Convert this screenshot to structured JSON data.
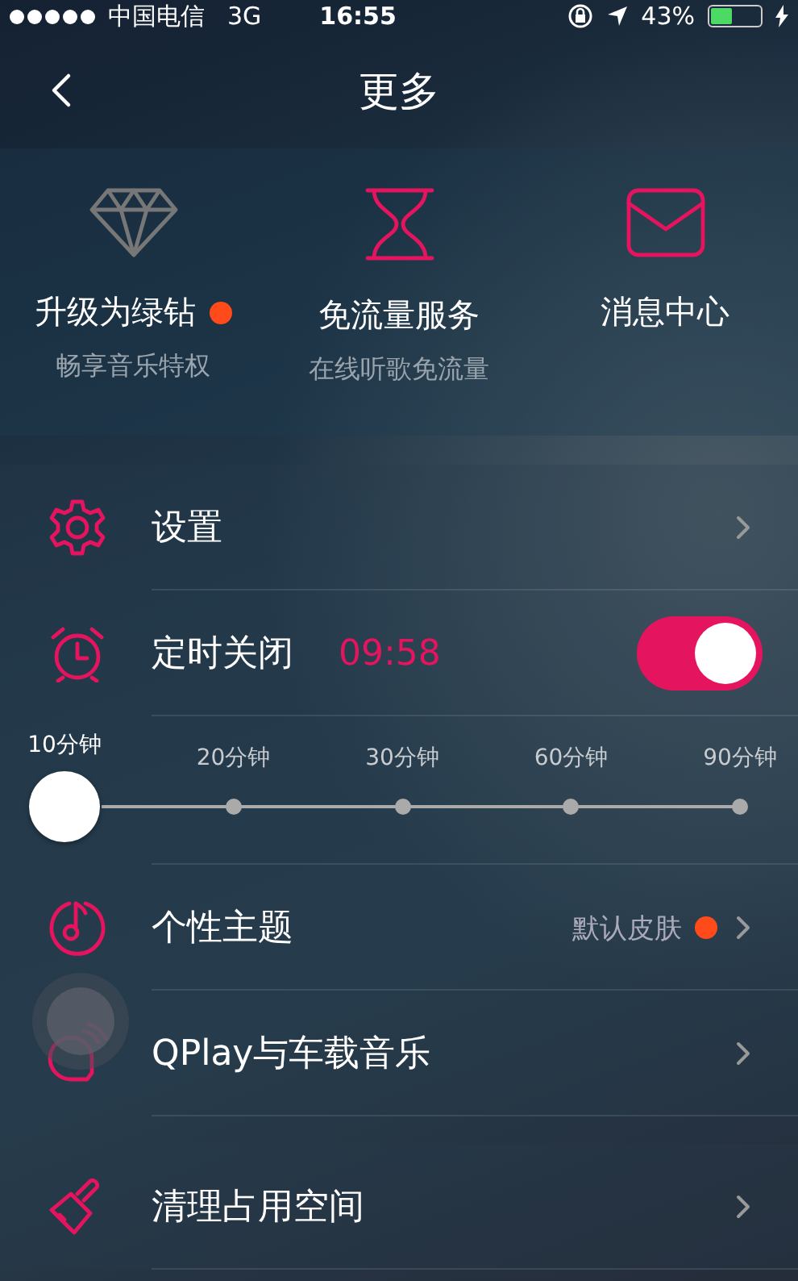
{
  "status_bar": {
    "carrier": "中国电信",
    "network": "3G",
    "time": "16:55",
    "battery": "43%"
  },
  "nav": {
    "title": "更多"
  },
  "features": [
    {
      "label": "升级为绿钻",
      "sublabel": "畅享音乐特权",
      "badge": true
    },
    {
      "label": "免流量服务",
      "sublabel": "在线听歌免流量",
      "badge": false
    },
    {
      "label": "消息中心",
      "badge": false
    }
  ],
  "menu": [
    {
      "kind": "link",
      "label": "设置"
    },
    {
      "kind": "toggle",
      "label": "定时关闭",
      "value": "09:58",
      "on": true
    },
    {
      "kind": "slider",
      "options": [
        {
          "label": "10分钟",
          "selected": true
        },
        {
          "label": "20分钟",
          "selected": false
        },
        {
          "label": "30分钟",
          "selected": false
        },
        {
          "label": "60分钟",
          "selected": false
        },
        {
          "label": "90分钟",
          "selected": false
        }
      ]
    },
    {
      "kind": "link",
      "label": "个性主题",
      "value": "默认皮肤",
      "badge": true
    },
    {
      "kind": "link",
      "label": "QPlay与车载音乐"
    }
  ],
  "menu_2": [
    {
      "kind": "link",
      "label": "清理占用空间"
    }
  ]
}
